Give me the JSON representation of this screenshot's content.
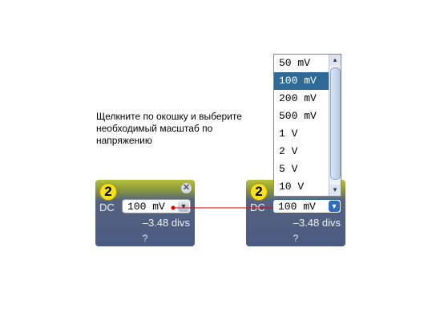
{
  "instruction": "Щелкните по окошку и выберите необходимый масштаб по напряжению",
  "panel_left": {
    "channel": "2",
    "close": "✕",
    "coupling": "DC",
    "scale": "100 mV",
    "offset": "–3.48 divs",
    "help": "?"
  },
  "panel_right": {
    "channel": "2",
    "coupling": "DC",
    "scale": "100 mV",
    "offset": "–3.48 divs",
    "help": "?"
  },
  "dropdown": {
    "options": [
      "50 mV",
      "100 mV",
      "200 mV",
      "500 mV",
      "1 V",
      "2 V",
      "5 V",
      "10 V"
    ],
    "selected": "100 mV"
  },
  "icons": {
    "dropdown_arrow": "▼",
    "scroll_up": "▲",
    "scroll_down": "▼"
  },
  "colors": {
    "panel": "#4b5a82",
    "panel_top": "#b6c23a",
    "badge": "#f6e21c",
    "selected": "#2f6a96",
    "connector": "#e00000"
  }
}
